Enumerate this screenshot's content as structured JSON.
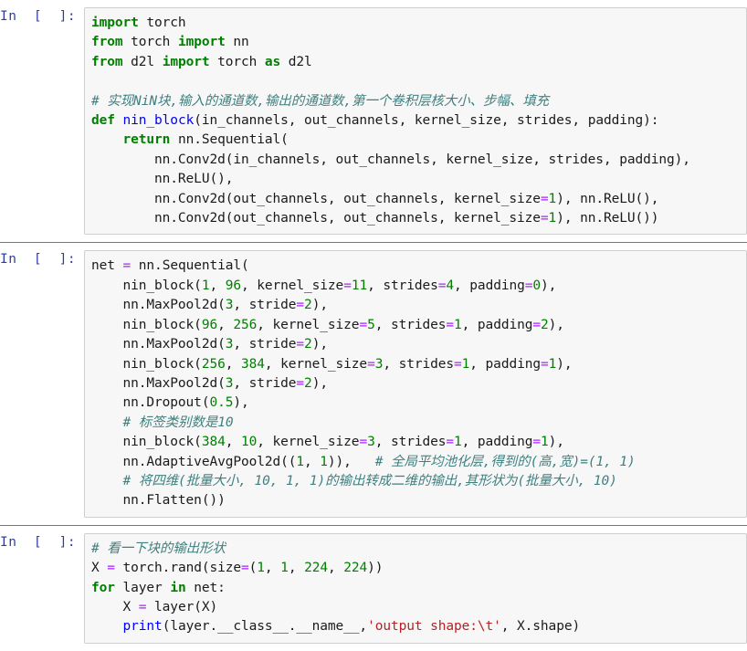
{
  "notebook": {
    "prompt_label": "In  [  ]:",
    "colors": {
      "keyword": "#008000",
      "function": "#0000FF",
      "number": "#008000",
      "string": "#BA2121",
      "operator": "#AA22FF",
      "comment": "#408080",
      "prompt": "#303F9F",
      "cell_background": "#f7f7f7",
      "cell_border": "#cfcfcf",
      "separator": "#3f9f3f"
    },
    "cells": [
      {
        "id": "cell-1",
        "prompt": "In  [  ]:",
        "lines": [
          [
            {
              "t": "import",
              "c": "k"
            },
            {
              "t": " torch",
              "c": "p"
            }
          ],
          [
            {
              "t": "from",
              "c": "k"
            },
            {
              "t": " torch ",
              "c": "p"
            },
            {
              "t": "import",
              "c": "k"
            },
            {
              "t": " nn",
              "c": "p"
            }
          ],
          [
            {
              "t": "from",
              "c": "k"
            },
            {
              "t": " d2l ",
              "c": "p"
            },
            {
              "t": "import",
              "c": "k"
            },
            {
              "t": " torch ",
              "c": "p"
            },
            {
              "t": "as",
              "c": "k"
            },
            {
              "t": " d2l",
              "c": "p"
            }
          ],
          [],
          [
            {
              "t": "# 实现NiN块,输入的通道数,输出的通道数,第一个卷积层核大小、步幅、填充",
              "c": "c"
            }
          ],
          [
            {
              "t": "def",
              "c": "k"
            },
            {
              "t": " ",
              "c": "p"
            },
            {
              "t": "nin_block",
              "c": "fn"
            },
            {
              "t": "(in_channels, out_channels, kernel_size, strides, padding):",
              "c": "p"
            }
          ],
          [
            {
              "t": "    ",
              "c": "p"
            },
            {
              "t": "return",
              "c": "k"
            },
            {
              "t": " nn.Sequential(",
              "c": "p"
            }
          ],
          [
            {
              "t": "        nn.Conv2d(in_channels, out_channels, kernel_size, strides, padding),",
              "c": "p"
            }
          ],
          [
            {
              "t": "        nn.ReLU(),",
              "c": "p"
            }
          ],
          [
            {
              "t": "        nn.Conv2d(out_channels, out_channels, kernel_size",
              "c": "p"
            },
            {
              "t": "=",
              "c": "o"
            },
            {
              "t": "1",
              "c": "n"
            },
            {
              "t": "), nn.ReLU(),",
              "c": "p"
            }
          ],
          [
            {
              "t": "        nn.Conv2d(out_channels, out_channels, kernel_size",
              "c": "p"
            },
            {
              "t": "=",
              "c": "o"
            },
            {
              "t": "1",
              "c": "n"
            },
            {
              "t": "), nn.ReLU())",
              "c": "p"
            }
          ]
        ]
      },
      {
        "id": "cell-2",
        "prompt": "In  [  ]:",
        "lines": [
          [
            {
              "t": "net ",
              "c": "p"
            },
            {
              "t": "=",
              "c": "o"
            },
            {
              "t": " nn.Sequential(",
              "c": "p"
            }
          ],
          [
            {
              "t": "    nin_block(",
              "c": "p"
            },
            {
              "t": "1",
              "c": "n"
            },
            {
              "t": ", ",
              "c": "p"
            },
            {
              "t": "96",
              "c": "n"
            },
            {
              "t": ", kernel_size",
              "c": "p"
            },
            {
              "t": "=",
              "c": "o"
            },
            {
              "t": "11",
              "c": "n"
            },
            {
              "t": ", strides",
              "c": "p"
            },
            {
              "t": "=",
              "c": "o"
            },
            {
              "t": "4",
              "c": "n"
            },
            {
              "t": ", padding",
              "c": "p"
            },
            {
              "t": "=",
              "c": "o"
            },
            {
              "t": "0",
              "c": "n"
            },
            {
              "t": "),",
              "c": "p"
            }
          ],
          [
            {
              "t": "    nn.MaxPool2d(",
              "c": "p"
            },
            {
              "t": "3",
              "c": "n"
            },
            {
              "t": ", stride",
              "c": "p"
            },
            {
              "t": "=",
              "c": "o"
            },
            {
              "t": "2",
              "c": "n"
            },
            {
              "t": "),",
              "c": "p"
            }
          ],
          [
            {
              "t": "    nin_block(",
              "c": "p"
            },
            {
              "t": "96",
              "c": "n"
            },
            {
              "t": ", ",
              "c": "p"
            },
            {
              "t": "256",
              "c": "n"
            },
            {
              "t": ", kernel_size",
              "c": "p"
            },
            {
              "t": "=",
              "c": "o"
            },
            {
              "t": "5",
              "c": "n"
            },
            {
              "t": ", strides",
              "c": "p"
            },
            {
              "t": "=",
              "c": "o"
            },
            {
              "t": "1",
              "c": "n"
            },
            {
              "t": ", padding",
              "c": "p"
            },
            {
              "t": "=",
              "c": "o"
            },
            {
              "t": "2",
              "c": "n"
            },
            {
              "t": "),",
              "c": "p"
            }
          ],
          [
            {
              "t": "    nn.MaxPool2d(",
              "c": "p"
            },
            {
              "t": "3",
              "c": "n"
            },
            {
              "t": ", stride",
              "c": "p"
            },
            {
              "t": "=",
              "c": "o"
            },
            {
              "t": "2",
              "c": "n"
            },
            {
              "t": "),",
              "c": "p"
            }
          ],
          [
            {
              "t": "    nin_block(",
              "c": "p"
            },
            {
              "t": "256",
              "c": "n"
            },
            {
              "t": ", ",
              "c": "p"
            },
            {
              "t": "384",
              "c": "n"
            },
            {
              "t": ", kernel_size",
              "c": "p"
            },
            {
              "t": "=",
              "c": "o"
            },
            {
              "t": "3",
              "c": "n"
            },
            {
              "t": ", strides",
              "c": "p"
            },
            {
              "t": "=",
              "c": "o"
            },
            {
              "t": "1",
              "c": "n"
            },
            {
              "t": ", padding",
              "c": "p"
            },
            {
              "t": "=",
              "c": "o"
            },
            {
              "t": "1",
              "c": "n"
            },
            {
              "t": "),",
              "c": "p"
            }
          ],
          [
            {
              "t": "    nn.MaxPool2d(",
              "c": "p"
            },
            {
              "t": "3",
              "c": "n"
            },
            {
              "t": ", stride",
              "c": "p"
            },
            {
              "t": "=",
              "c": "o"
            },
            {
              "t": "2",
              "c": "n"
            },
            {
              "t": "),",
              "c": "p"
            }
          ],
          [
            {
              "t": "    nn.Dropout(",
              "c": "p"
            },
            {
              "t": "0.5",
              "c": "n"
            },
            {
              "t": "),",
              "c": "p"
            }
          ],
          [
            {
              "t": "    ",
              "c": "p"
            },
            {
              "t": "# 标签类别数是10",
              "c": "c"
            }
          ],
          [
            {
              "t": "    nin_block(",
              "c": "p"
            },
            {
              "t": "384",
              "c": "n"
            },
            {
              "t": ", ",
              "c": "p"
            },
            {
              "t": "10",
              "c": "n"
            },
            {
              "t": ", kernel_size",
              "c": "p"
            },
            {
              "t": "=",
              "c": "o"
            },
            {
              "t": "3",
              "c": "n"
            },
            {
              "t": ", strides",
              "c": "p"
            },
            {
              "t": "=",
              "c": "o"
            },
            {
              "t": "1",
              "c": "n"
            },
            {
              "t": ", padding",
              "c": "p"
            },
            {
              "t": "=",
              "c": "o"
            },
            {
              "t": "1",
              "c": "n"
            },
            {
              "t": "),",
              "c": "p"
            }
          ],
          [
            {
              "t": "    nn.AdaptiveAvgPool2d((",
              "c": "p"
            },
            {
              "t": "1",
              "c": "n"
            },
            {
              "t": ", ",
              "c": "p"
            },
            {
              "t": "1",
              "c": "n"
            },
            {
              "t": ")),   ",
              "c": "p"
            },
            {
              "t": "# 全局平均池化层,得到的(高,宽)=(1, 1)",
              "c": "c"
            }
          ],
          [
            {
              "t": "    ",
              "c": "p"
            },
            {
              "t": "# 将四维(批量大小, 10, 1, 1)的输出转成二维的输出,其形状为(批量大小, 10)",
              "c": "c"
            }
          ],
          [
            {
              "t": "    nn.Flatten())",
              "c": "p"
            }
          ]
        ]
      },
      {
        "id": "cell-3",
        "prompt": "In  [  ]:",
        "lines": [
          [
            {
              "t": "# 看一下块的输出形状",
              "c": "c"
            }
          ],
          [
            {
              "t": "X ",
              "c": "p"
            },
            {
              "t": "=",
              "c": "o"
            },
            {
              "t": " torch.rand(size",
              "c": "p"
            },
            {
              "t": "=",
              "c": "o"
            },
            {
              "t": "(",
              "c": "p"
            },
            {
              "t": "1",
              "c": "n"
            },
            {
              "t": ", ",
              "c": "p"
            },
            {
              "t": "1",
              "c": "n"
            },
            {
              "t": ", ",
              "c": "p"
            },
            {
              "t": "224",
              "c": "n"
            },
            {
              "t": ", ",
              "c": "p"
            },
            {
              "t": "224",
              "c": "n"
            },
            {
              "t": "))",
              "c": "p"
            }
          ],
          [
            {
              "t": "for",
              "c": "k"
            },
            {
              "t": " layer ",
              "c": "p"
            },
            {
              "t": "in",
              "c": "k"
            },
            {
              "t": " net:",
              "c": "p"
            }
          ],
          [
            {
              "t": "    X ",
              "c": "p"
            },
            {
              "t": "=",
              "c": "o"
            },
            {
              "t": " layer(X)",
              "c": "p"
            }
          ],
          [
            {
              "t": "    ",
              "c": "p"
            },
            {
              "t": "print",
              "c": "fn"
            },
            {
              "t": "(layer.__class__.__name__,",
              "c": "p"
            },
            {
              "t": "'output shape:\\t'",
              "c": "s"
            },
            {
              "t": ", X.shape)",
              "c": "p"
            }
          ]
        ]
      }
    ]
  }
}
